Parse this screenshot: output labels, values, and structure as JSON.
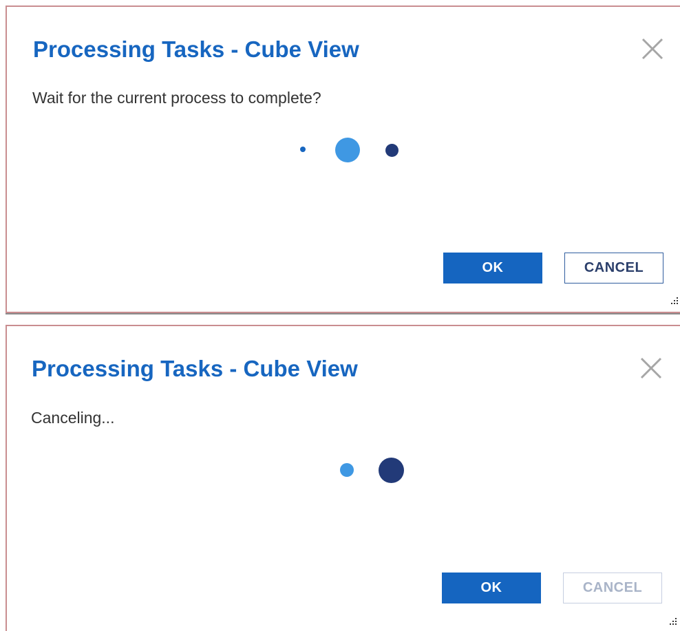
{
  "colors": {
    "title": "#1766c0",
    "primary_button": "#1565c0",
    "dot_light": "#3f98e3",
    "dot_dark": "#223a78",
    "dialog_border": "#c98d90"
  },
  "dialogs": [
    {
      "title": "Processing Tasks - Cube View",
      "message": "Wait for the current process to complete?",
      "close_icon": "close-icon",
      "loader_icon": "loading-dots-icon",
      "ok_label": "OK",
      "cancel_label": "CANCEL",
      "cancel_disabled": false,
      "resize_icon": "resize-grip-icon"
    },
    {
      "title": "Processing Tasks - Cube View",
      "message": "Canceling...",
      "close_icon": "close-icon",
      "loader_icon": "loading-dots-icon",
      "ok_label": "OK",
      "cancel_label": "CANCEL",
      "cancel_disabled": true,
      "resize_icon": "resize-grip-icon"
    }
  ]
}
